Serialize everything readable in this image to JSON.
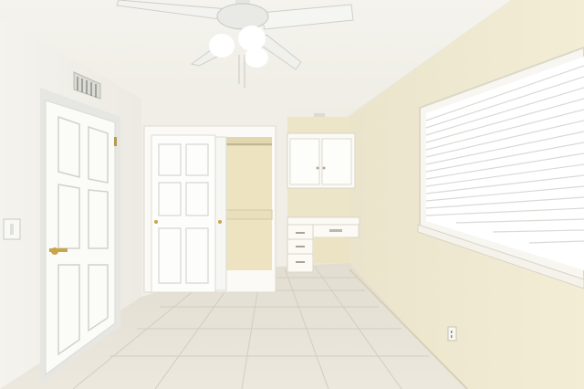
{
  "scene": {
    "description_visible_text": "",
    "colors": {
      "wall": "#f1ecd6",
      "wall_shadow": "#e6e0c6",
      "ceiling": "#f6f4ec",
      "floor": "#e8e3d8",
      "trim": "#fbfaf5",
      "window_light": "#ffffff",
      "blind_line": "#d9d9d6"
    },
    "objects": [
      "ceiling-fan",
      "air-vent",
      "entry-door",
      "closet",
      "built-in-desk",
      "wall-cabinets",
      "window-with-blinds",
      "light-switch",
      "outlet",
      "tile-floor"
    ]
  }
}
